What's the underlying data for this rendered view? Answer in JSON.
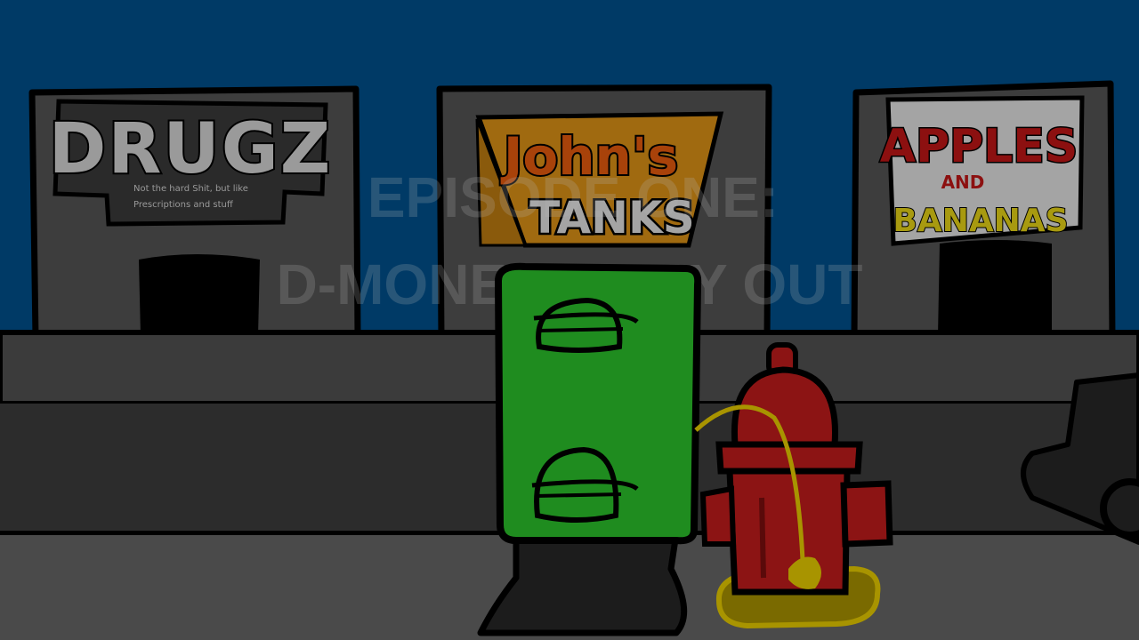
{
  "scene": {
    "title_line1": "EPISODE ONE:",
    "title_line2": "D-MONEY'S DAY OUT"
  },
  "shops": {
    "drugz": {
      "name": "DRUGZ",
      "subtitle_line1": "Not the hard Shit, but like",
      "subtitle_line2": "Prescriptions and stuff"
    },
    "johns": {
      "name_line1": "John's",
      "name_line2": "TANKS"
    },
    "apples": {
      "name_line1": "APPLES",
      "name_line2": "AND",
      "name_line3": "BANANAS"
    }
  },
  "colors": {
    "sky": "#003a66",
    "building": "#3d3d3d",
    "sidewalk": "#3b3b3b",
    "road": "#4a4a4a",
    "tank": "#1f8c1f",
    "hydrant": "#8c1414",
    "pee": "#b0a000",
    "johns_sign_bg": "#a06a10",
    "johns_sign_text": "#a8420a",
    "apples_text": "#8c1010",
    "bananas_text": "#a89a10"
  },
  "icons": {
    "tank_marks": "hat-symbol",
    "hydrant": "fire-hydrant",
    "car": "car"
  }
}
